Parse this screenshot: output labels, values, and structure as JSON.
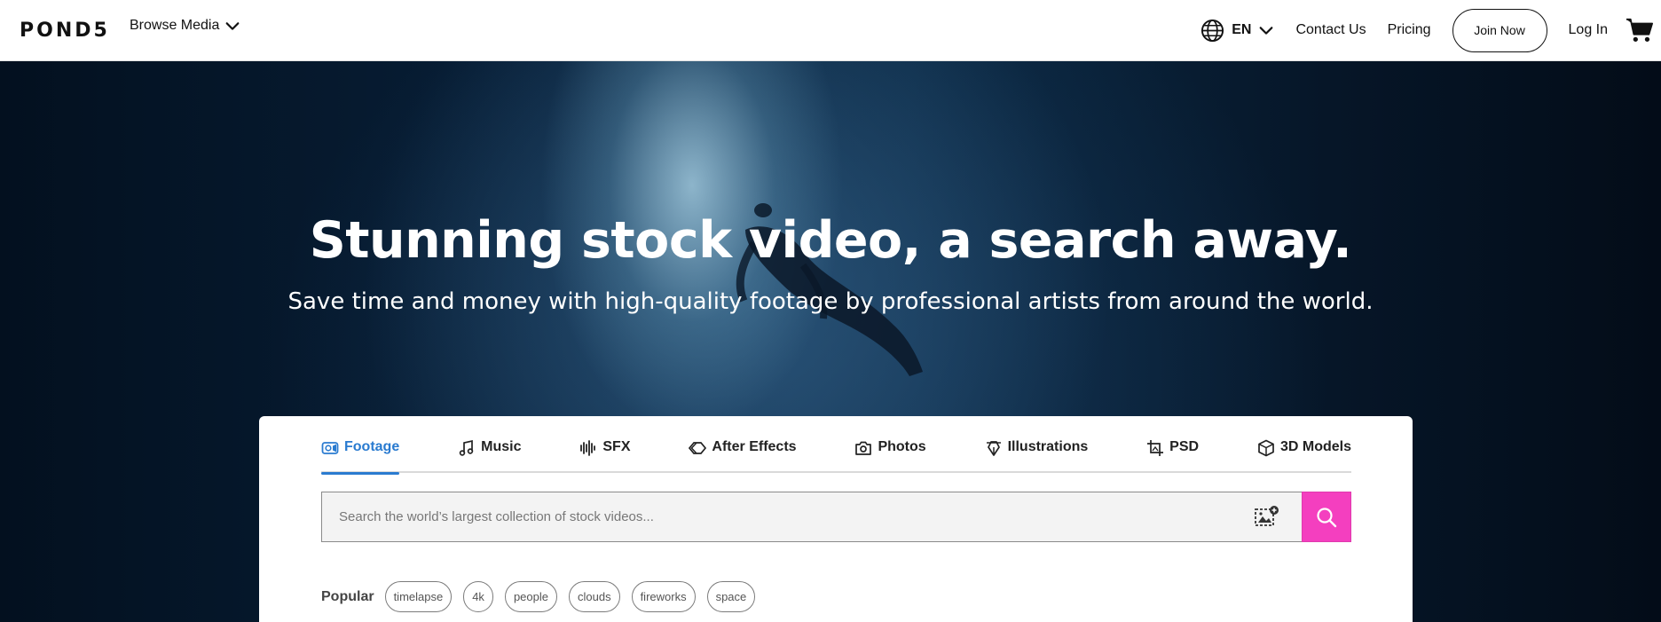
{
  "header": {
    "logo": "POND5",
    "browse_label": "Browse Media",
    "language": "EN",
    "contact_label": "Contact Us",
    "pricing_label": "Pricing",
    "join_label": "Join Now",
    "login_label": "Log In"
  },
  "hero": {
    "title": "Stunning stock video, a search away.",
    "subtitle": "Save time and money with high-quality footage by professional artists from around the world."
  },
  "search": {
    "tabs": [
      {
        "label": "Footage",
        "icon": "video-camera-icon",
        "active": true
      },
      {
        "label": "Music",
        "icon": "music-note-icon"
      },
      {
        "label": "SFX",
        "icon": "sound-wave-icon"
      },
      {
        "label": "After Effects",
        "icon": "after-effects-icon"
      },
      {
        "label": "Photos",
        "icon": "camera-icon"
      },
      {
        "label": "Illustrations",
        "icon": "pen-nib-icon"
      },
      {
        "label": "PSD",
        "icon": "crop-icon"
      },
      {
        "label": "3D Models",
        "icon": "cube-icon"
      }
    ],
    "placeholder": "Search the world’s largest collection of stock videos...",
    "popular_label": "Popular",
    "popular_tags": [
      "timelapse",
      "4k",
      "people",
      "clouds",
      "fireworks",
      "space"
    ]
  },
  "colors": {
    "accent_blue": "#2a7bd0",
    "search_button": "#f43fbf"
  }
}
